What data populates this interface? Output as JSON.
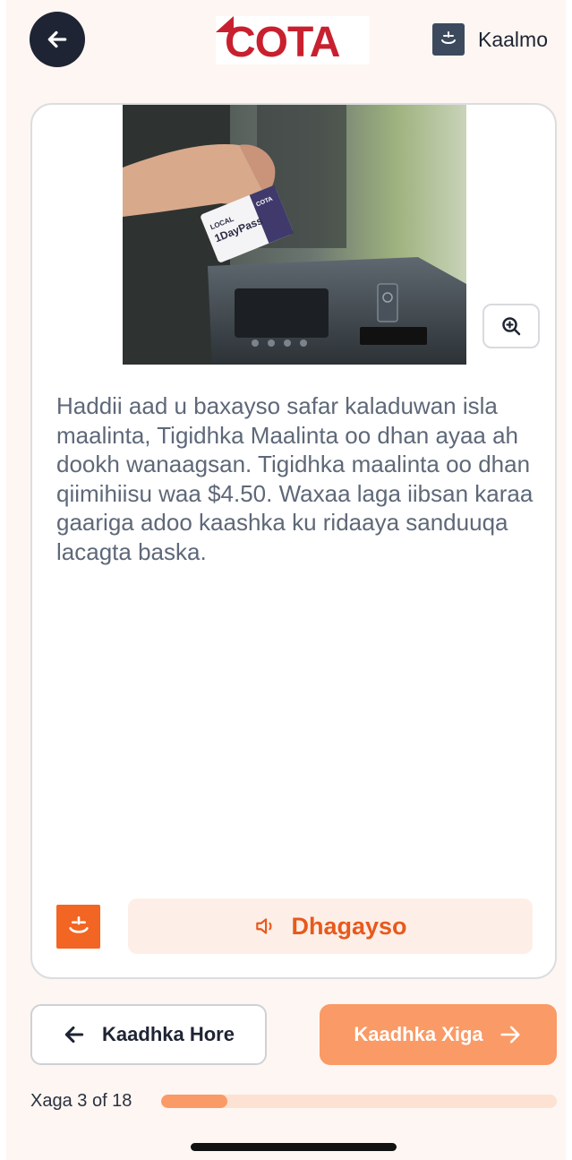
{
  "header": {
    "brand": "COTA",
    "help_label": "Kaalmo"
  },
  "card": {
    "body_text": "Haddii aad u baxayso safar kaladuwan isla maalinta, Tigidhka Maalinta oo dhan ayaa ah dookh wanaagsan. Tigidhka maalinta oo dhan qiimihiisu waa $4.50. Waxaa laga iibsan karaa gaariga adoo kaashka ku ridaaya sanduuqa lacagta baska.",
    "listen_label": "Dhagayso",
    "pass_card_text": {
      "line1": "LOCAL",
      "line2": "1DayPass",
      "brand": "COTA"
    }
  },
  "nav": {
    "prev_label": "Kaadhka Hore",
    "next_label": "Kaadhka Xiga"
  },
  "progress": {
    "label": "Xaga 3 of 18",
    "current": 3,
    "total": 18
  },
  "colors": {
    "brand_red": "#c8202f",
    "accent_orange": "#f26522",
    "button_orange": "#fa9a66",
    "dark_navy": "#1e2433"
  }
}
